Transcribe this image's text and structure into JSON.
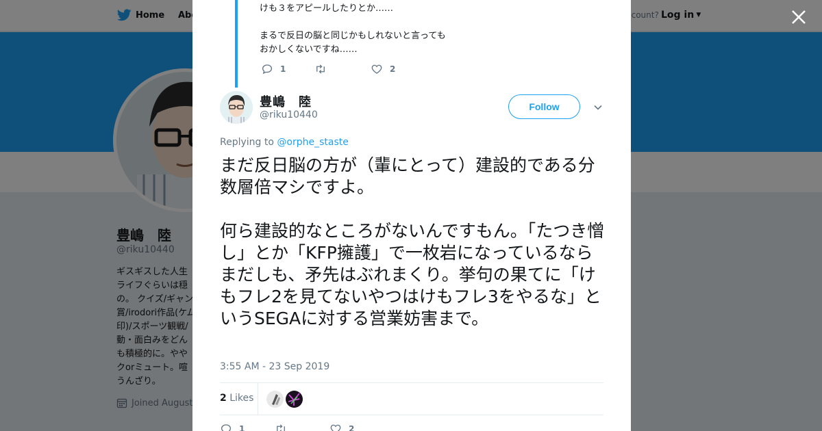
{
  "colors": {
    "accent": "#1da1f2",
    "overlay": "rgba(0,0,0,0.5)"
  },
  "topbar": {
    "home_label": "Home",
    "about_label": "Abo",
    "account_text": "ccount?",
    "login_label": "Log in"
  },
  "background_profile": {
    "name": "豊嶋　陸",
    "handle": "@riku10440",
    "bio": "ギスギスした人生\nライフぐらいは穏\nの。 クイズ/ギャン\n賞/irodori作品(ケム\n印)/スポーツ観戦/\n動・面白みをどん\nも積極的に。やや\nクorミュート。喧\nうんざり。",
    "joined": "Joined August"
  },
  "previous_tweet": {
    "text": "けも３をアピールしたりとか……\n\nまるで反日の脳と同じかもしれないと言っても\nおかしくないですね……",
    "reply_count": "1",
    "retweet_count": "",
    "like_count": "2"
  },
  "tweet": {
    "user_name": "豊嶋　陸",
    "handle": "@riku10440",
    "follow_label": "Follow",
    "replying_prefix": "Replying to",
    "replying_to": "@orphe_staste",
    "text": "まだ反日脳の方が（輩にとって）建設的である分数層倍マシですよ。\n\n何ら建設的なところがないんですもん。「たつき憎し」とか「KFP擁護」で一枚岩になっているならまだしも、矛先はぶれまくり。挙句の果てに「けもフレ2を見てないやつはけもフレ3をやるな」というSEGAに対する営業妨害まで。",
    "timestamp": "3:55 AM - 23 Sep 2019",
    "likes_count": "2",
    "likes_label": "Likes",
    "reply_count": "1",
    "retweet_count": "",
    "like_count": "2"
  }
}
